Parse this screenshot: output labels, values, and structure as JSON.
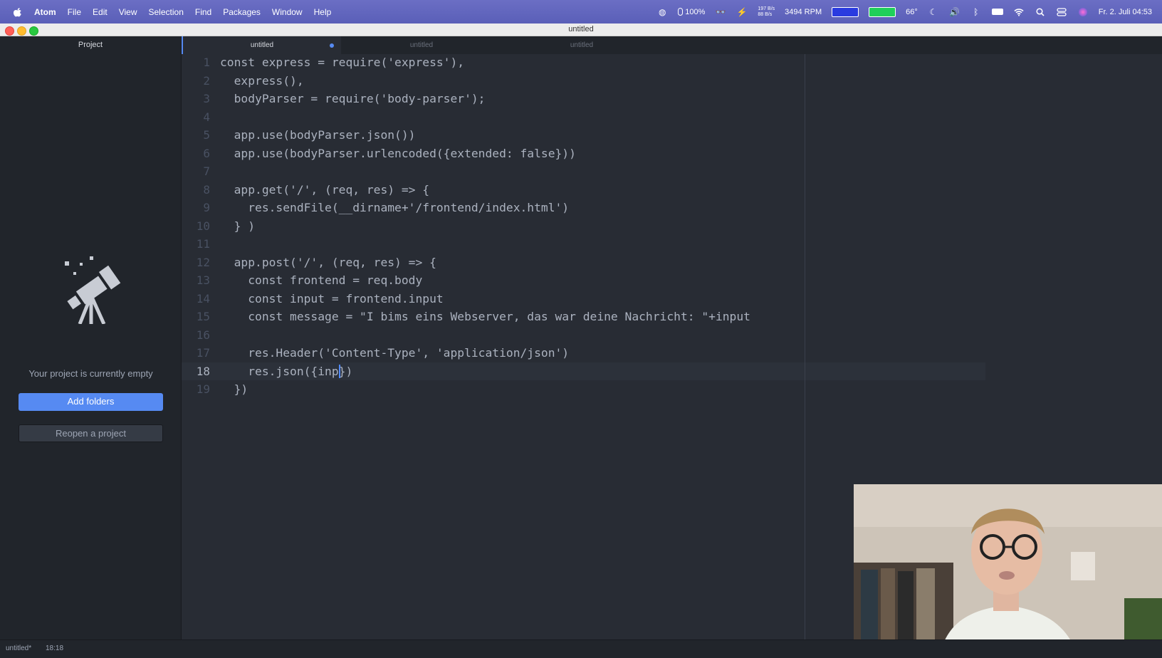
{
  "menubar": {
    "app": "Atom",
    "items": [
      "File",
      "Edit",
      "View",
      "Selection",
      "Find",
      "Packages",
      "Window",
      "Help"
    ],
    "battery_percent": "100%",
    "net_up": "197 B/s",
    "net_down": "88 B/s",
    "fan": "3494 RPM",
    "temperature": "66°",
    "datetime": "Fr. 2. Juli  04:53"
  },
  "window": {
    "title": "untitled"
  },
  "sidebar": {
    "title": "Project",
    "empty_message": "Your project is currently empty",
    "add_folders": "Add folders",
    "reopen": "Reopen a project"
  },
  "tabs": [
    {
      "label": "untitled",
      "active": true,
      "modified": true
    },
    {
      "label": "untitled",
      "active": false,
      "modified": false
    },
    {
      "label": "untitled",
      "active": false,
      "modified": false
    }
  ],
  "editor": {
    "current_line": 18,
    "lines": [
      "const express = require('express'),",
      "  express(),",
      "  bodyParser = require('body-parser');",
      "",
      "  app.use(bodyParser.json())",
      "  app.use(bodyParser.urlencoded({extended: false}))",
      "",
      "  app.get('/', (req, res) => {",
      "    res.sendFile(__dirname+'/frontend/index.html')",
      "  } )",
      "",
      "  app.post('/', (req, res) => {",
      "    const frontend = req.body",
      "    const input = frontend.input",
      "    const message = \"I bims eins Webserver, das war deine Nachricht: \"+input",
      "",
      "    res.Header('Content-Type', 'application/json')",
      "    res.json({inp})",
      "  })"
    ]
  },
  "statusbar": {
    "file": "untitled*",
    "position": "18:18"
  },
  "colors": {
    "accent": "#568af2",
    "editor_bg": "#282c34",
    "sidebar_bg": "#21252b",
    "menubar": "#5d62ba"
  }
}
